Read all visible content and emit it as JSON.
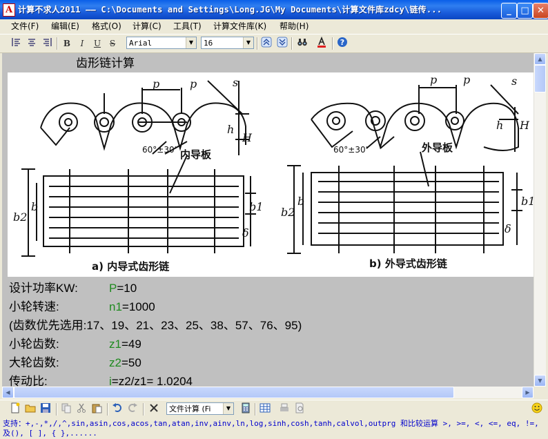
{
  "window": {
    "title": "计算不求人2011 —— C:\\Documents and Settings\\Long.JG\\My Documents\\计算文件库zdcy\\链传...",
    "app_icon": "A",
    "minimize": "_",
    "maximize": "□",
    "close": "✕"
  },
  "menu": [
    {
      "label": "文件(F)"
    },
    {
      "label": "编辑(E)"
    },
    {
      "label": "格式(O)"
    },
    {
      "label": "计算(C)"
    },
    {
      "label": "工具(T)"
    },
    {
      "label": "计算文件库(K)"
    },
    {
      "label": "帮助(H)"
    }
  ],
  "toolbar": {
    "bold": "B",
    "italic": "I",
    "underline": "U",
    "strike": "S",
    "font_name": "Arial",
    "font_size": "16"
  },
  "sheet": {
    "title": "齿形链计算",
    "figure_labels": {
      "p": "p",
      "s": "s",
      "h": "h",
      "H": "H",
      "angle": "60°±30'",
      "inner_plate": "内导板",
      "outer_plate": "外导板",
      "b": "b",
      "b1": "b1",
      "b2": "b2",
      "delta": "δ",
      "caption_a": "a) 内导式齿形链",
      "caption_b": "b) 外导式齿形链"
    },
    "lines": [
      {
        "label": "设计功率KW:",
        "var": "P",
        "expr": "=10"
      },
      {
        "label": "小轮转速:",
        "var": "n1",
        "expr": "=1000"
      },
      {
        "label": "(齿数优先选用:17、19、21、23、25、38、57、76、95)",
        "var": "",
        "expr": ""
      },
      {
        "label": "小轮齿数:",
        "var": "z1",
        "expr": "=49"
      },
      {
        "label": "大轮齿数:",
        "var": "z2",
        "expr": "=50"
      },
      {
        "label": "传动比:",
        "var": "i",
        "expr": "=z2/z1= 1.0204"
      }
    ]
  },
  "bottom_toolbar": {
    "file_combo": "文件计算 (Fi"
  },
  "status": {
    "text": "支持：+,-,*,/,^,sin,asin,cos,acos,tan,atan,inv,ainv,ln,log,sinh,cosh,tanh,calvol,outprg 和比较运算 >, >=, <, <=, eq, !=, 及(), [ ], { },......"
  }
}
